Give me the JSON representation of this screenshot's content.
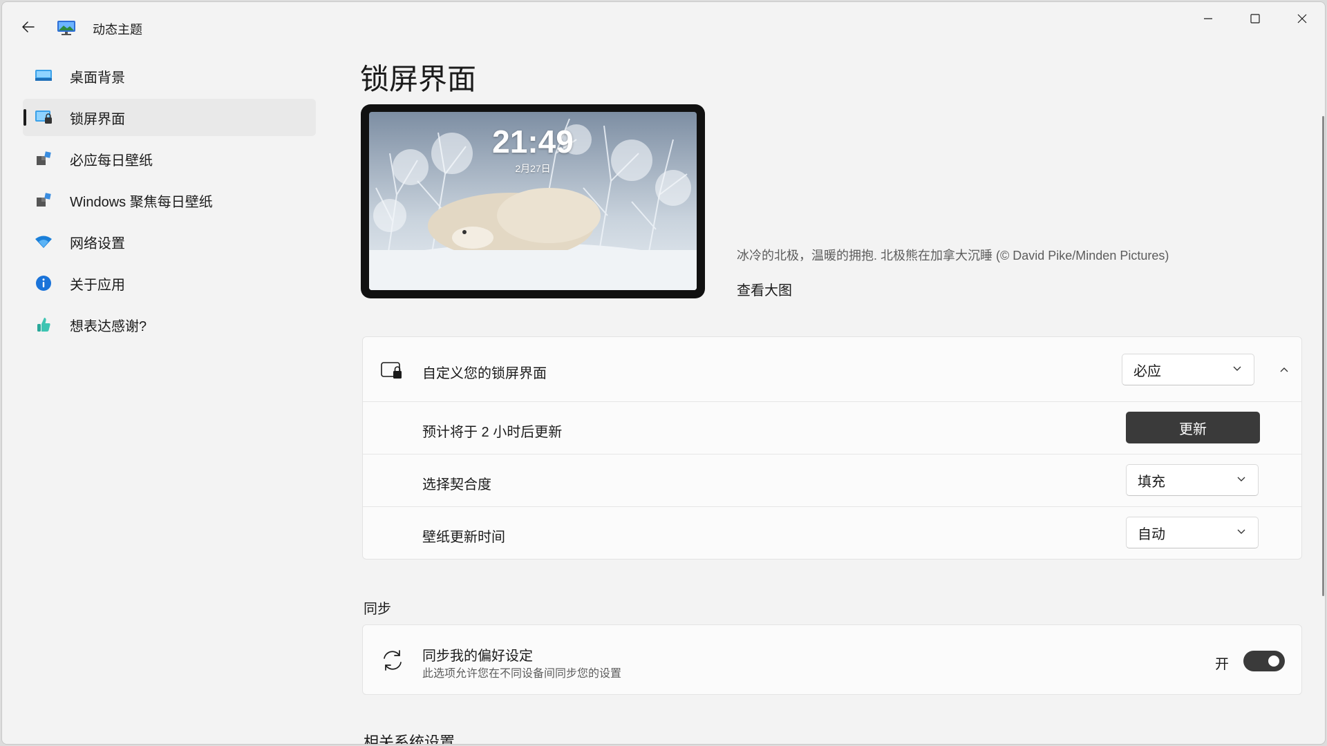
{
  "window": {
    "title": "动态主题",
    "accent": "#3a3a3a"
  },
  "sidebar": {
    "items": [
      {
        "label": "桌面背景",
        "icon": "desktop-background-icon",
        "active": false
      },
      {
        "label": "锁屏界面",
        "icon": "lock-screen-icon",
        "active": true
      },
      {
        "label": "必应每日壁纸",
        "icon": "bing-wallpaper-icon",
        "active": false
      },
      {
        "label": "Windows 聚焦每日壁纸",
        "icon": "spotlight-wallpaper-icon",
        "active": false
      },
      {
        "label": "网络设置",
        "icon": "wifi-icon",
        "active": false
      },
      {
        "label": "关于应用",
        "icon": "info-icon",
        "active": false
      },
      {
        "label": "想表达感谢?",
        "icon": "thumbs-up-icon",
        "active": false
      }
    ]
  },
  "main": {
    "page_title": "锁屏界面",
    "preview": {
      "time": "21:49",
      "date": "2月27日"
    },
    "image_caption": "冰冷的北极，温暖的拥抱. 北极熊在加拿大沉睡 (© David Pike/Minden Pictures)",
    "view_large_link": "查看大图",
    "customize": {
      "label": "自定义您的锁屏界面",
      "source_value": "必应",
      "rows": [
        {
          "label": "预计将于 2 小时后更新",
          "button": "更新"
        },
        {
          "label": "选择契合度",
          "dropdown": "填充"
        },
        {
          "label": "壁纸更新时间",
          "dropdown": "自动"
        }
      ]
    },
    "sync_section": {
      "title": "同步",
      "item_title": "同步我的偏好设定",
      "item_desc": "此选项允许您在不同设备间同步您的设置",
      "toggle_label": "开",
      "toggle_on": true
    },
    "related_title": "相关系统设置"
  }
}
